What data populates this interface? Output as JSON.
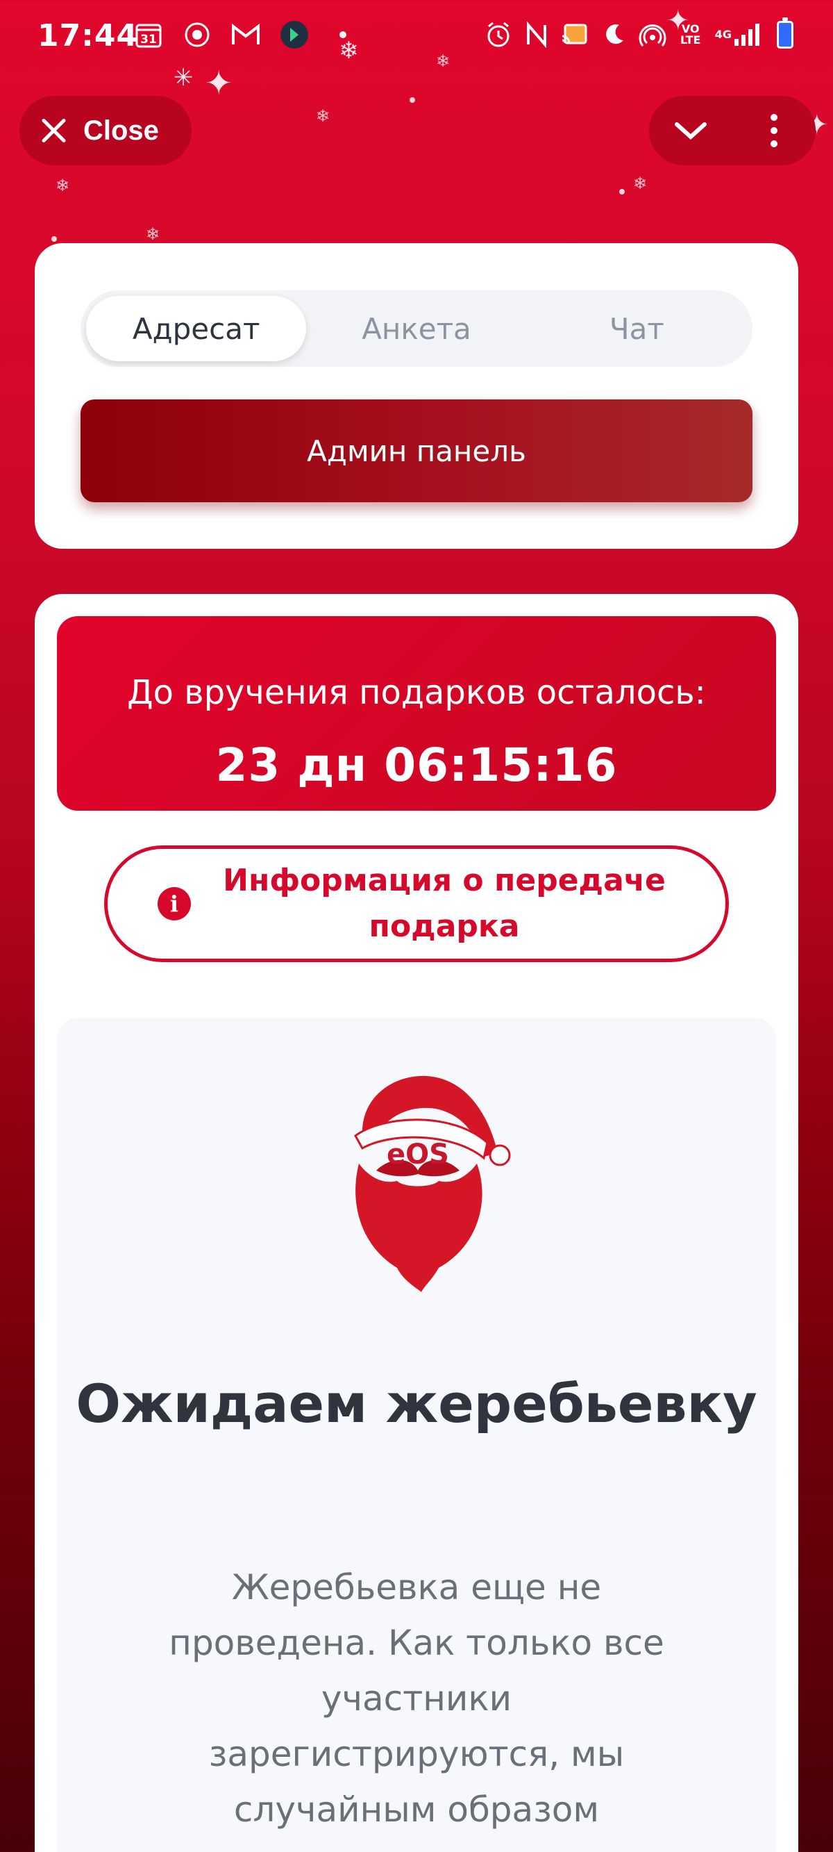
{
  "status_bar": {
    "time": "17:44",
    "calendar_day": "31",
    "network_label_top": "VO",
    "network_label_bottom": "LTE",
    "network_gen": "4G"
  },
  "top_controls": {
    "close_label": "Close"
  },
  "tabs": [
    {
      "label": "Адресат",
      "active": true
    },
    {
      "label": "Анкета",
      "active": false
    },
    {
      "label": "Чат",
      "active": false
    }
  ],
  "admin_button": {
    "label": "Админ панель"
  },
  "countdown": {
    "label": "До вручения подарков осталось:",
    "value": "23 дн 06:15:16"
  },
  "info_button": {
    "label": "Информация о передаче подарка"
  },
  "wait": {
    "logo_text": "eOS",
    "title": "Ожидаем жеребьевку",
    "description": "Жеребьевка еще не проведена. Как только все участники зарегистрируются, мы случайным образом"
  },
  "colors": {
    "brand_red": "#d6082b",
    "admin_dark_red": "#8e0008"
  }
}
